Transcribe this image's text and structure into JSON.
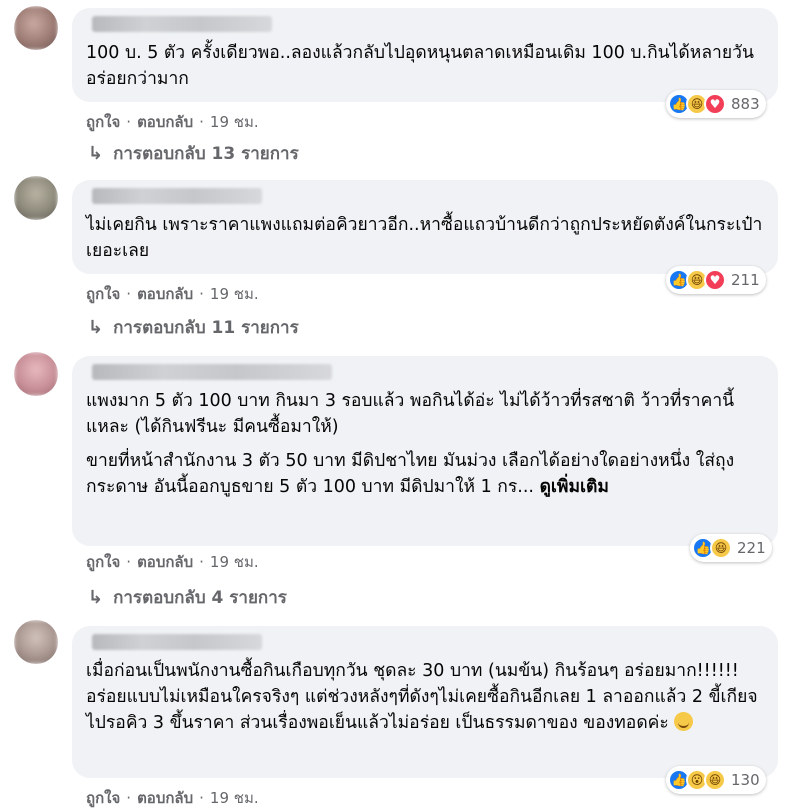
{
  "comments": [
    {
      "text": "100 บ. 5 ตัว ครั้งเดียวพอ..ลองแล้วกลับไปอุดหนุนตลาดเหมือนเดิม 100 บ.กินได้หลายวันอร่อยกว่ามาก",
      "reactions": {
        "icons": [
          "like-icon",
          "haha-icon",
          "love-icon"
        ],
        "count": "883"
      },
      "like_label": "ถูกใจ",
      "reply_label": "ตอบกลับ",
      "time": "19 ชม.",
      "replies_label": "การตอบกลับ 13 รายการ"
    },
    {
      "text": "ไม่เคยกิน เพราะราคาแพงแถมต่อคิวยาวอีก..หาซื้อแถวบ้านดีกว่าถูกประหยัดตังค์ในกระเป๋าเยอะเลย",
      "reactions": {
        "icons": [
          "like-icon",
          "haha-icon",
          "love-icon"
        ],
        "count": "211"
      },
      "like_label": "ถูกใจ",
      "reply_label": "ตอบกลับ",
      "time": "19 ชม.",
      "replies_label": "การตอบกลับ 11 รายการ"
    },
    {
      "text": "แพงมาก 5 ตัว 100 บาท กินมา 3 รอบแล้ว พอกินได้อ่ะ ไม่ได้ว้าวที่รสชาติ ว้าวที่ราคานี้แหละ (ได้กินฟรีนะ มีคนซื้อมาให้)",
      "text2": "ขายที่หน้าสำนักงาน 3 ตัว 50 บาท มีดิปชาไทย มันม่วง เลือกได้อย่างใดอย่างหนึ่ง ใส่ถุงกระดาษ อันนี้ออกบูธขาย 5 ตัว 100 บาท มีดิปมาให้ 1 กร...",
      "see_more": "ดูเพิ่มเติม",
      "reactions": {
        "icons": [
          "like-icon",
          "haha-icon"
        ],
        "count": "221"
      },
      "like_label": "ถูกใจ",
      "reply_label": "ตอบกลับ",
      "time": "19 ชม.",
      "replies_label": "การตอบกลับ 4 รายการ"
    },
    {
      "text": "เมื่อก่อนเป็นพนักงานซื้อกินเกือบทุกวัน ชุดละ 30 บาท (นมข้น) กินร้อนๆ อร่อยมาก!!!!!! อร่อยแบบไม่เหมือนใครจริงๆ แต่ช่วงหลังๆที่ดังๆไม่เคยซื้อกินอีกเลย 1 ลาออกแล้ว 2 ขี้เกียจไปรอคิว 3 ขึ้นราคา ส่วนเรื่องพอเย็นแล้วไม่อร่อย เป็นธรรมดาของ ของทอดค่ะ",
      "reactions": {
        "icons": [
          "like-icon",
          "wow-icon",
          "haha-icon"
        ],
        "count": "130"
      },
      "like_label": "ถูกใจ",
      "reply_label": "ตอบกลับ",
      "time": "19 ชม."
    }
  ],
  "separator": "·",
  "reply_arrow": "↳",
  "colors": {
    "bubble": "#f0f2f5",
    "meta_text": "#65676b",
    "like": "#1877f2",
    "love": "#f33e58",
    "haha": "#f7c948"
  }
}
